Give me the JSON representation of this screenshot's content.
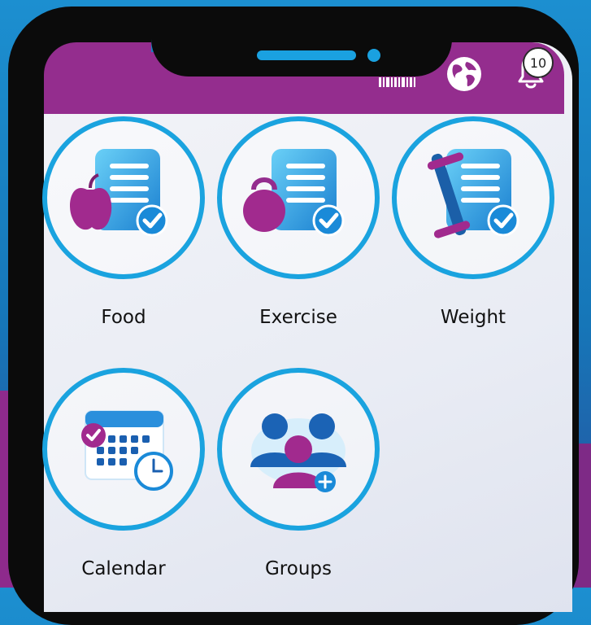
{
  "notifications": {
    "count": "10"
  },
  "tiles": [
    {
      "label": "Food"
    },
    {
      "label": "Exercise"
    },
    {
      "label": "Weight"
    },
    {
      "label": "Calendar"
    },
    {
      "label": "Groups"
    }
  ],
  "colors": {
    "header": "#942d8e",
    "ring": "#1aa3df",
    "accent_magenta": "#a12a8e",
    "document_blue": "#1aa1e0"
  }
}
